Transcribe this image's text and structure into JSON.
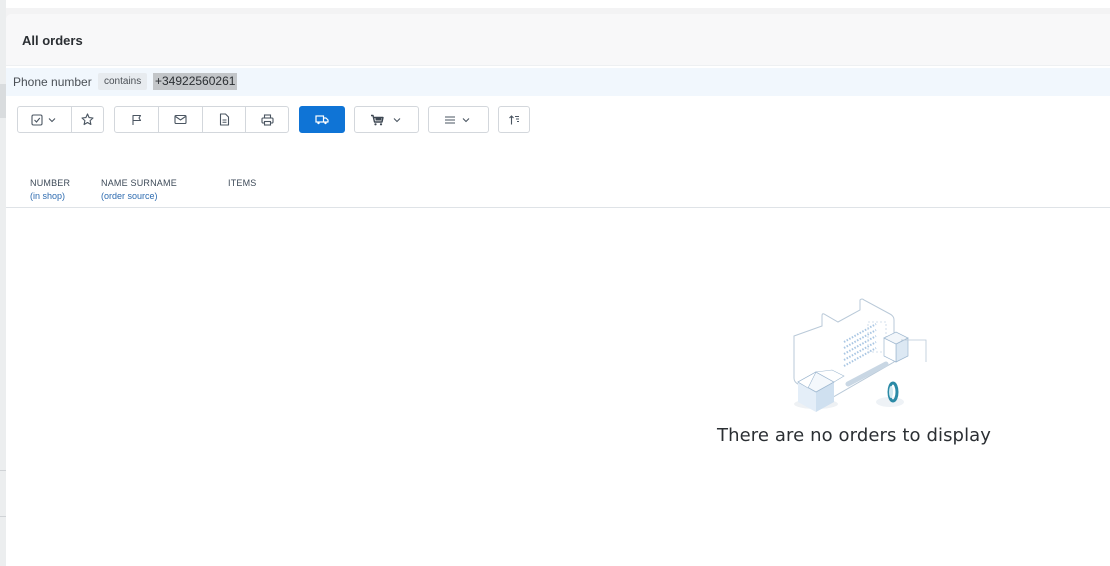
{
  "header": {
    "title": "All orders"
  },
  "filter": {
    "field_label": "Phone number",
    "operator": "contains",
    "value": "+34922560261"
  },
  "toolbar": {
    "buttons": [
      {
        "icon": "checkbox-icon"
      },
      {
        "icon": "star-icon"
      },
      {
        "icon": "flag-icon"
      },
      {
        "icon": "envelope-icon"
      },
      {
        "icon": "document-icon"
      },
      {
        "icon": "printer-icon"
      },
      {
        "icon": "truck-icon"
      },
      {
        "icon": "cart-icon"
      },
      {
        "icon": "menu-icon"
      },
      {
        "icon": "sort-icon"
      }
    ],
    "accent_color": "#0f74d6"
  },
  "table": {
    "columns": [
      {
        "label": "NUMBER",
        "sub": "(in shop)"
      },
      {
        "label": "NAME SURNAME",
        "sub": "(order source)"
      },
      {
        "label": "ITEMS",
        "sub": ""
      }
    ]
  },
  "empty_state": {
    "message": "There are no orders to display"
  }
}
